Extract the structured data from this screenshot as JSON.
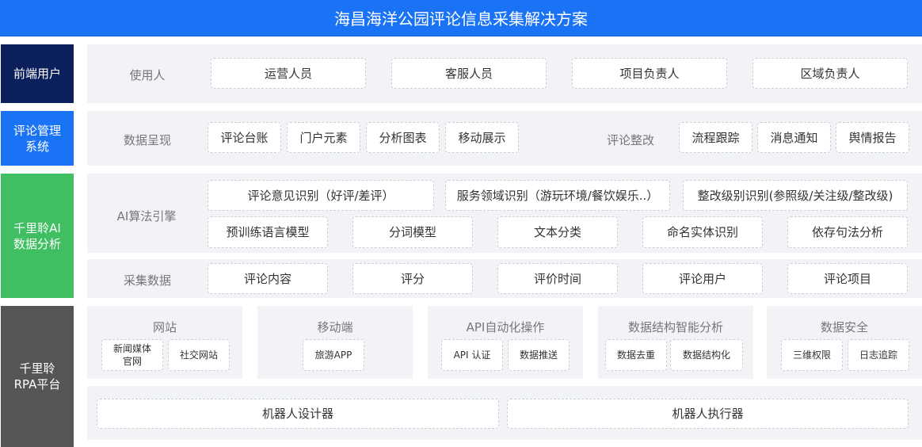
{
  "title": "海昌海洋公园评论信息采集解决方案",
  "sides": {
    "front": "前端用户",
    "mgmt": "评论管理\n系统",
    "ai": "千里聆AI\n数据分析",
    "rpa": "千里聆\nRPA平台"
  },
  "users": {
    "label": "使用人",
    "items": [
      "运营人员",
      "客服人员",
      "项目负责人",
      "区域负责人"
    ]
  },
  "mgmt": {
    "display_label": "数据呈现",
    "display_items": [
      "评论台账",
      "门户元素",
      "分析图表",
      "移动展示"
    ],
    "fix_label": "评论整改",
    "fix_items": [
      "流程跟踪",
      "消息通知",
      "舆情报告"
    ]
  },
  "ai_engine": {
    "label": "AI算法引擎",
    "row1": [
      "评论意见识别（好评/差评）",
      "服务领域识别（游玩环境/餐饮娱乐..）",
      "整改级别识别(参照级/关注级/整改级)"
    ],
    "row2": [
      "预训练语言模型",
      "分词模型",
      "文本分类",
      "命名实体识别",
      "依存句法分析"
    ]
  },
  "collect": {
    "label": "采集数据",
    "items": [
      "评论内容",
      "评分",
      "评价时间",
      "评论用户",
      "评论项目"
    ]
  },
  "rpa": {
    "groups": [
      {
        "title": "网站",
        "items": [
          "新闻媒体\n官网",
          "社交网站"
        ]
      },
      {
        "title": "移动端",
        "items": [
          "旅游APP"
        ]
      },
      {
        "title": "API自动化操作",
        "items": [
          "API 认证",
          "数据推送"
        ]
      },
      {
        "title": "数据结构智能分析",
        "items": [
          "数据去重",
          "数据结构化"
        ]
      },
      {
        "title": "数据安全",
        "items": [
          "三维权限",
          "日志追踪"
        ]
      }
    ],
    "tools": [
      "机器人设计器",
      "机器人执行器"
    ]
  },
  "colors": {
    "title_bg": "#1a73f5",
    "navy": "#0b1f5c",
    "blue": "#1a73f5",
    "green": "#3fbf62",
    "gray": "#555555",
    "panel": "#f1f3f7"
  }
}
